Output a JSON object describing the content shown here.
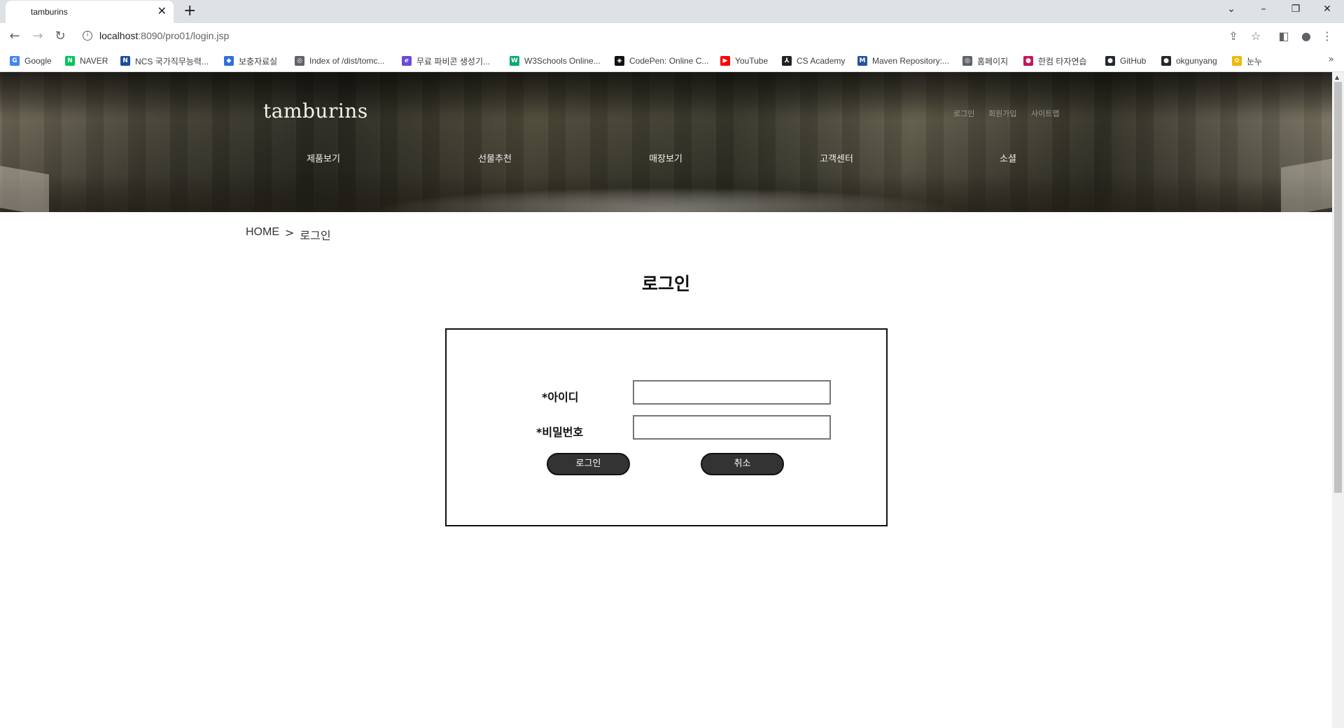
{
  "browser": {
    "tab_title": "tamburins",
    "tab_close": "✕",
    "new_tab": "+",
    "window_controls": [
      "⌄",
      "–",
      "❐",
      "✕"
    ],
    "url_host": "localhost",
    "url_rest": ":8090/pro01/login.jsp",
    "bookmarks": [
      {
        "label": "Google",
        "icon": "google-icon",
        "color": "#4285f4",
        "glyph": "G"
      },
      {
        "label": "NAVER",
        "icon": "naver-icon",
        "color": "#03c75a",
        "glyph": "N"
      },
      {
        "label": "NCS 국가직무능력...",
        "icon": "ncs-icon",
        "color": "#1a4fa0",
        "glyph": "N"
      },
      {
        "label": "보충자료실",
        "icon": "hexagon-icon",
        "color": "#2f6fdc",
        "glyph": "◆"
      },
      {
        "label": "Index of /dist/tomc...",
        "icon": "globe-icon",
        "color": "#5f6368",
        "glyph": "◎"
      },
      {
        "label": "무료 파비콘 생성기...",
        "icon": "favicon-generator-icon",
        "color": "#6a4bd6",
        "glyph": "ℯ"
      },
      {
        "label": "W3Schools Online...",
        "icon": "w3schools-icon",
        "color": "#04aa6d",
        "glyph": "W"
      },
      {
        "label": "CodePen: Online C...",
        "icon": "codepen-icon",
        "color": "#111111",
        "glyph": "◈"
      },
      {
        "label": "YouTube",
        "icon": "youtube-icon",
        "color": "#ff0000",
        "glyph": "▶"
      },
      {
        "label": "CS Academy",
        "icon": "cs-academy-icon",
        "color": "#222222",
        "glyph": "⅄"
      },
      {
        "label": "Maven Repository:...",
        "icon": "maven-icon",
        "color": "#2553a3",
        "glyph": "M"
      },
      {
        "label": "홈페이지",
        "icon": "globe-icon",
        "color": "#5f6368",
        "glyph": "◎"
      },
      {
        "label": "한컴 타자연습",
        "icon": "hancom-icon",
        "color": "#c2185b",
        "glyph": "●"
      },
      {
        "label": "GitHub",
        "icon": "github-icon",
        "color": "#24292f",
        "glyph": "●"
      },
      {
        "label": "okgunyang",
        "icon": "github-icon",
        "color": "#24292f",
        "glyph": "●"
      },
      {
        "label": "눈누",
        "icon": "noonnu-icon",
        "color": "#f2b705",
        "glyph": "✿"
      }
    ],
    "bookmarks_more": "»"
  },
  "site": {
    "brand": "tamburins",
    "util_links": [
      "로그인",
      "회원가입",
      "사이트맵"
    ],
    "gnb": [
      "제품보기",
      "선물추천",
      "매장보기",
      "고객센터",
      "소셜"
    ],
    "breadcrumb": {
      "home": "HOME",
      "separator": ">",
      "current": "로그인"
    },
    "page_title": "로그인",
    "form": {
      "id_label": "*아이디",
      "id_value": "",
      "pw_label": "*비밀번호",
      "pw_value": "",
      "login_button": "로그인",
      "cancel_button": "취소"
    }
  }
}
